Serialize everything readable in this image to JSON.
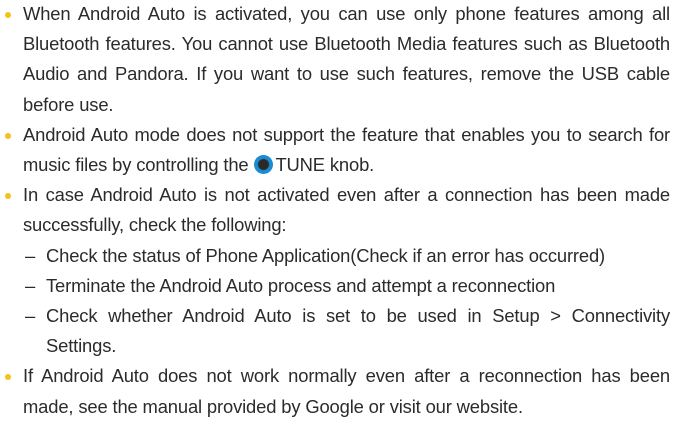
{
  "bullets": [
    {
      "text": "When Android Auto is activated, you can use only phone features among all Bluetooth features. You cannot use Bluetooth Media features such as Bluetooth Audio and Pandora. If you want to use such features, remove the USB cable before use."
    },
    {
      "text_before": "Android Auto mode does not support the feature that enables you to search for music files by controlling the",
      "knob_icon": "tune-knob-icon",
      "text_after": "TUNE knob."
    },
    {
      "text": "In case Android Auto is not activated even after a connection has been made successfully, check the following:",
      "sub_items": [
        {
          "dash": "–",
          "text": "Check the status of Phone Application(Check if an error has occurred)"
        },
        {
          "dash": "–",
          "text": "Terminate the Android Auto process and attempt a reconnection"
        },
        {
          "dash": "–",
          "text": "Check whether Android Auto is set to be used in Setup > Connectivity Settings."
        }
      ]
    },
    {
      "text": "If Android Auto does not work normally even after a reconnection has been made, see the manual provided by Google or visit our website."
    }
  ],
  "colors": {
    "bullet": "#f5c217",
    "text": "#2b2b2b",
    "knob_ring": "#1b8bd2",
    "knob_center": "#2a2a2a"
  }
}
